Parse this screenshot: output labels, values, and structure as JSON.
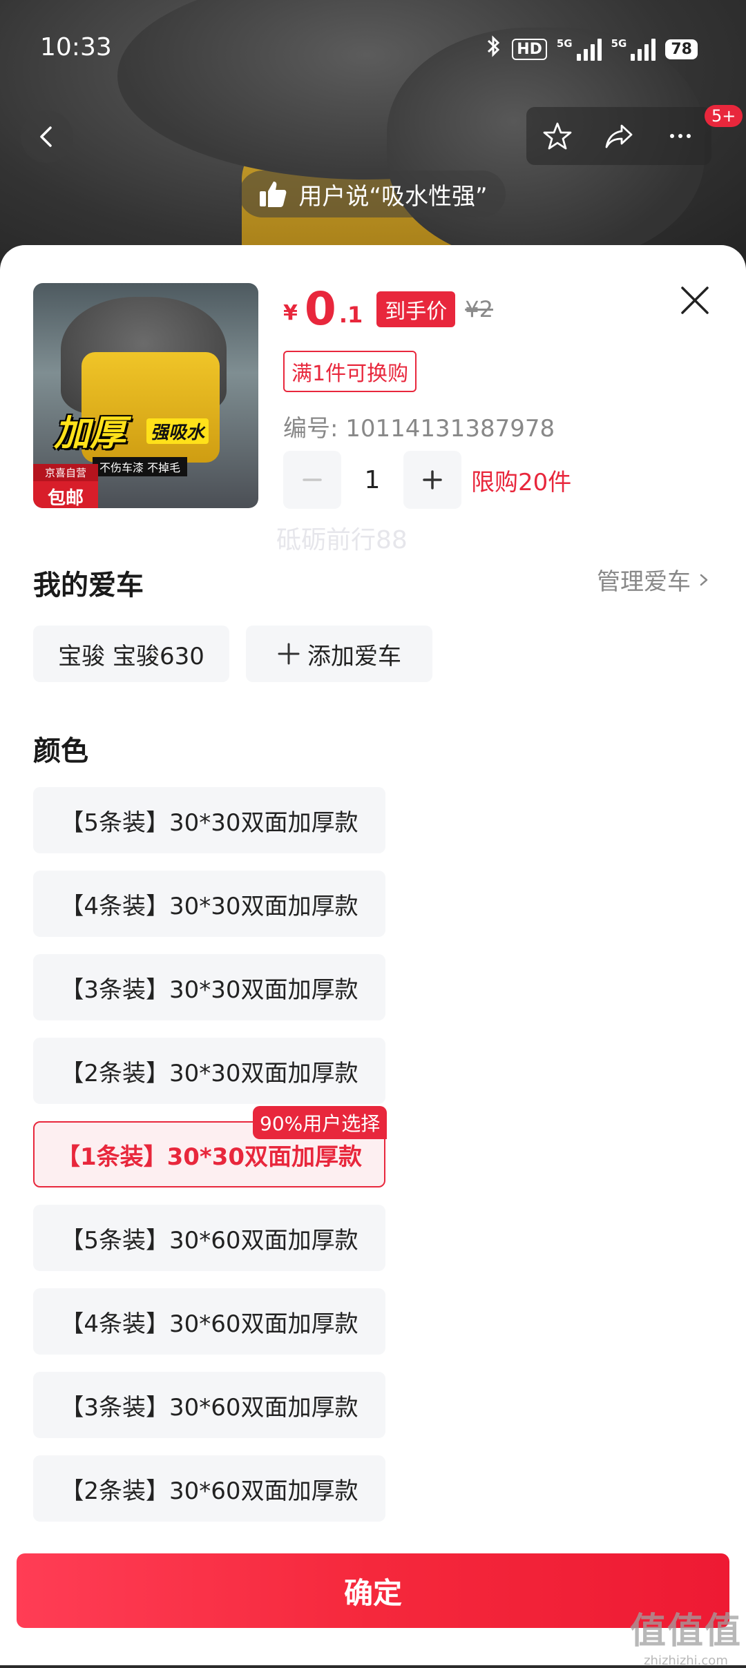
{
  "status_bar": {
    "time": "10:33",
    "hd": "HD",
    "net1": "5G",
    "net2": "5G",
    "battery": "78"
  },
  "nav": {
    "badge_count": "5+"
  },
  "review_pill": {
    "text": "用户说“吸水性强”"
  },
  "product": {
    "thumb_title": "加厚",
    "thumb_sub": "强吸水",
    "thumb_caption": "不伤车漆  不掉毛",
    "thumb_tag_line1": "京喜自营",
    "thumb_tag_line2": "包邮",
    "price_currency": "¥",
    "price_int": "0",
    "price_dec": ".1",
    "price_tag": "到手价",
    "price_original": "¥2",
    "exchange_badge": "满1件可换购",
    "sku_no": "编号: 10114131387978",
    "quantity": "1",
    "limit_text": "限购20件"
  },
  "my_car": {
    "title": "我的爱车",
    "manage_label": "管理爱车",
    "car_name": "宝骏 宝骏630",
    "add_car_label": "添加爱车"
  },
  "color": {
    "title": "颜色",
    "options": [
      "【5条装】30*30双面加厚款",
      "【4条装】30*30双面加厚款",
      "【3条装】30*30双面加厚款",
      "【2条装】30*30双面加厚款",
      "【1条装】30*30双面加厚款",
      "【5条装】30*60双面加厚款",
      "【4条装】30*60双面加厚款",
      "【3条装】30*60双面加厚款",
      "【2条装】30*60双面加厚款"
    ],
    "selected_index": 4,
    "selected_badge": "90%用户选择"
  },
  "watermark": "砥砺前行88",
  "confirm_label": "确定",
  "corner_logo": {
    "big": "值值值",
    "small": "zhizhizhi.com"
  },
  "colors": {
    "accent": "#e8273c",
    "chip_bg": "#f5f6f8",
    "selected_bg": "#fdeff1"
  }
}
